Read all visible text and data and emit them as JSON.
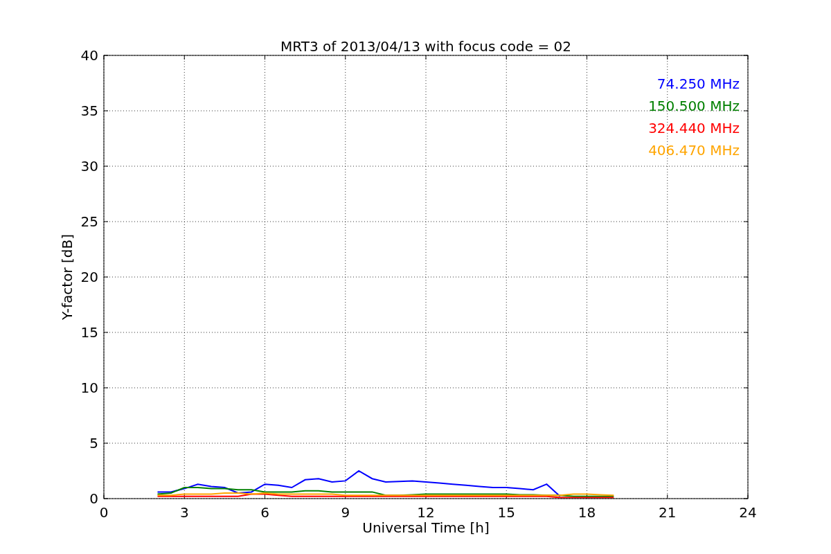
{
  "figure": {
    "chart_data": {
      "type": "line",
      "title": "MRT3 of 2013/04/13 with focus code = 02",
      "xlabel": "Universal Time [h]",
      "ylabel": "Y-factor [dB]",
      "x": [
        2,
        2.5,
        3,
        3.5,
        4,
        4.5,
        5,
        5.5,
        6,
        6.5,
        7,
        7.5,
        8,
        8.5,
        9,
        9.5,
        10,
        10.5,
        11,
        11.5,
        12,
        12.5,
        13,
        13.5,
        14,
        14.5,
        15,
        15.5,
        16,
        16.5,
        17,
        17.5,
        18,
        18.5,
        19
      ],
      "series": [
        {
          "name": "74.250 MHz",
          "color": "#0000ff",
          "values": [
            0.6,
            0.6,
            0.9,
            1.3,
            1.1,
            1.0,
            0.5,
            0.6,
            1.3,
            1.2,
            1.0,
            1.7,
            1.8,
            1.5,
            1.6,
            2.5,
            1.8,
            1.5,
            1.55,
            1.6,
            1.5,
            1.4,
            1.3,
            1.2,
            1.1,
            1.0,
            1.0,
            0.9,
            0.8,
            1.3,
            0.2,
            null,
            null,
            null,
            null
          ]
        },
        {
          "name": "150.500 MHz",
          "color": "#008000",
          "values": [
            0.4,
            0.5,
            1.0,
            1.0,
            0.9,
            0.9,
            0.8,
            0.8,
            0.6,
            0.6,
            0.6,
            0.7,
            0.7,
            0.6,
            0.6,
            0.6,
            0.6,
            0.3,
            0.3,
            0.35,
            0.4,
            0.4,
            0.4,
            0.4,
            0.4,
            0.4,
            0.4,
            0.35,
            0.35,
            0.3,
            0.3,
            0.2,
            0.2,
            0.2,
            0.2
          ]
        },
        {
          "name": "324.440 MHz",
          "color": "#ff0000",
          "values": [
            0.2,
            0.2,
            0.2,
            0.2,
            0.2,
            0.2,
            0.2,
            0.4,
            0.4,
            0.3,
            0.2,
            0.2,
            0.2,
            0.2,
            0.2,
            0.2,
            0.2,
            0.2,
            0.2,
            0.2,
            0.2,
            0.2,
            0.2,
            0.2,
            0.2,
            0.2,
            0.2,
            0.2,
            0.2,
            0.2,
            0.1,
            0.1,
            0.1,
            0.1,
            0.1
          ]
        },
        {
          "name": "406.470 MHz",
          "color": "#ffa500",
          "values": [
            0.3,
            0.3,
            0.4,
            0.4,
            0.4,
            0.5,
            0.5,
            0.4,
            0.5,
            0.4,
            0.4,
            0.4,
            0.4,
            0.4,
            0.3,
            0.3,
            0.3,
            0.3,
            0.3,
            0.3,
            0.3,
            0.3,
            0.3,
            0.3,
            0.3,
            0.3,
            0.3,
            0.3,
            0.3,
            0.3,
            0.3,
            0.4,
            0.4,
            0.35,
            0.3
          ]
        }
      ],
      "xlim": [
        0,
        24
      ],
      "ylim": [
        0,
        40
      ],
      "xticks": [
        0,
        3,
        6,
        9,
        12,
        15,
        18,
        21,
        24
      ],
      "yticks": [
        0,
        5,
        10,
        15,
        20,
        25,
        30,
        35,
        40
      ],
      "grid": true
    }
  }
}
